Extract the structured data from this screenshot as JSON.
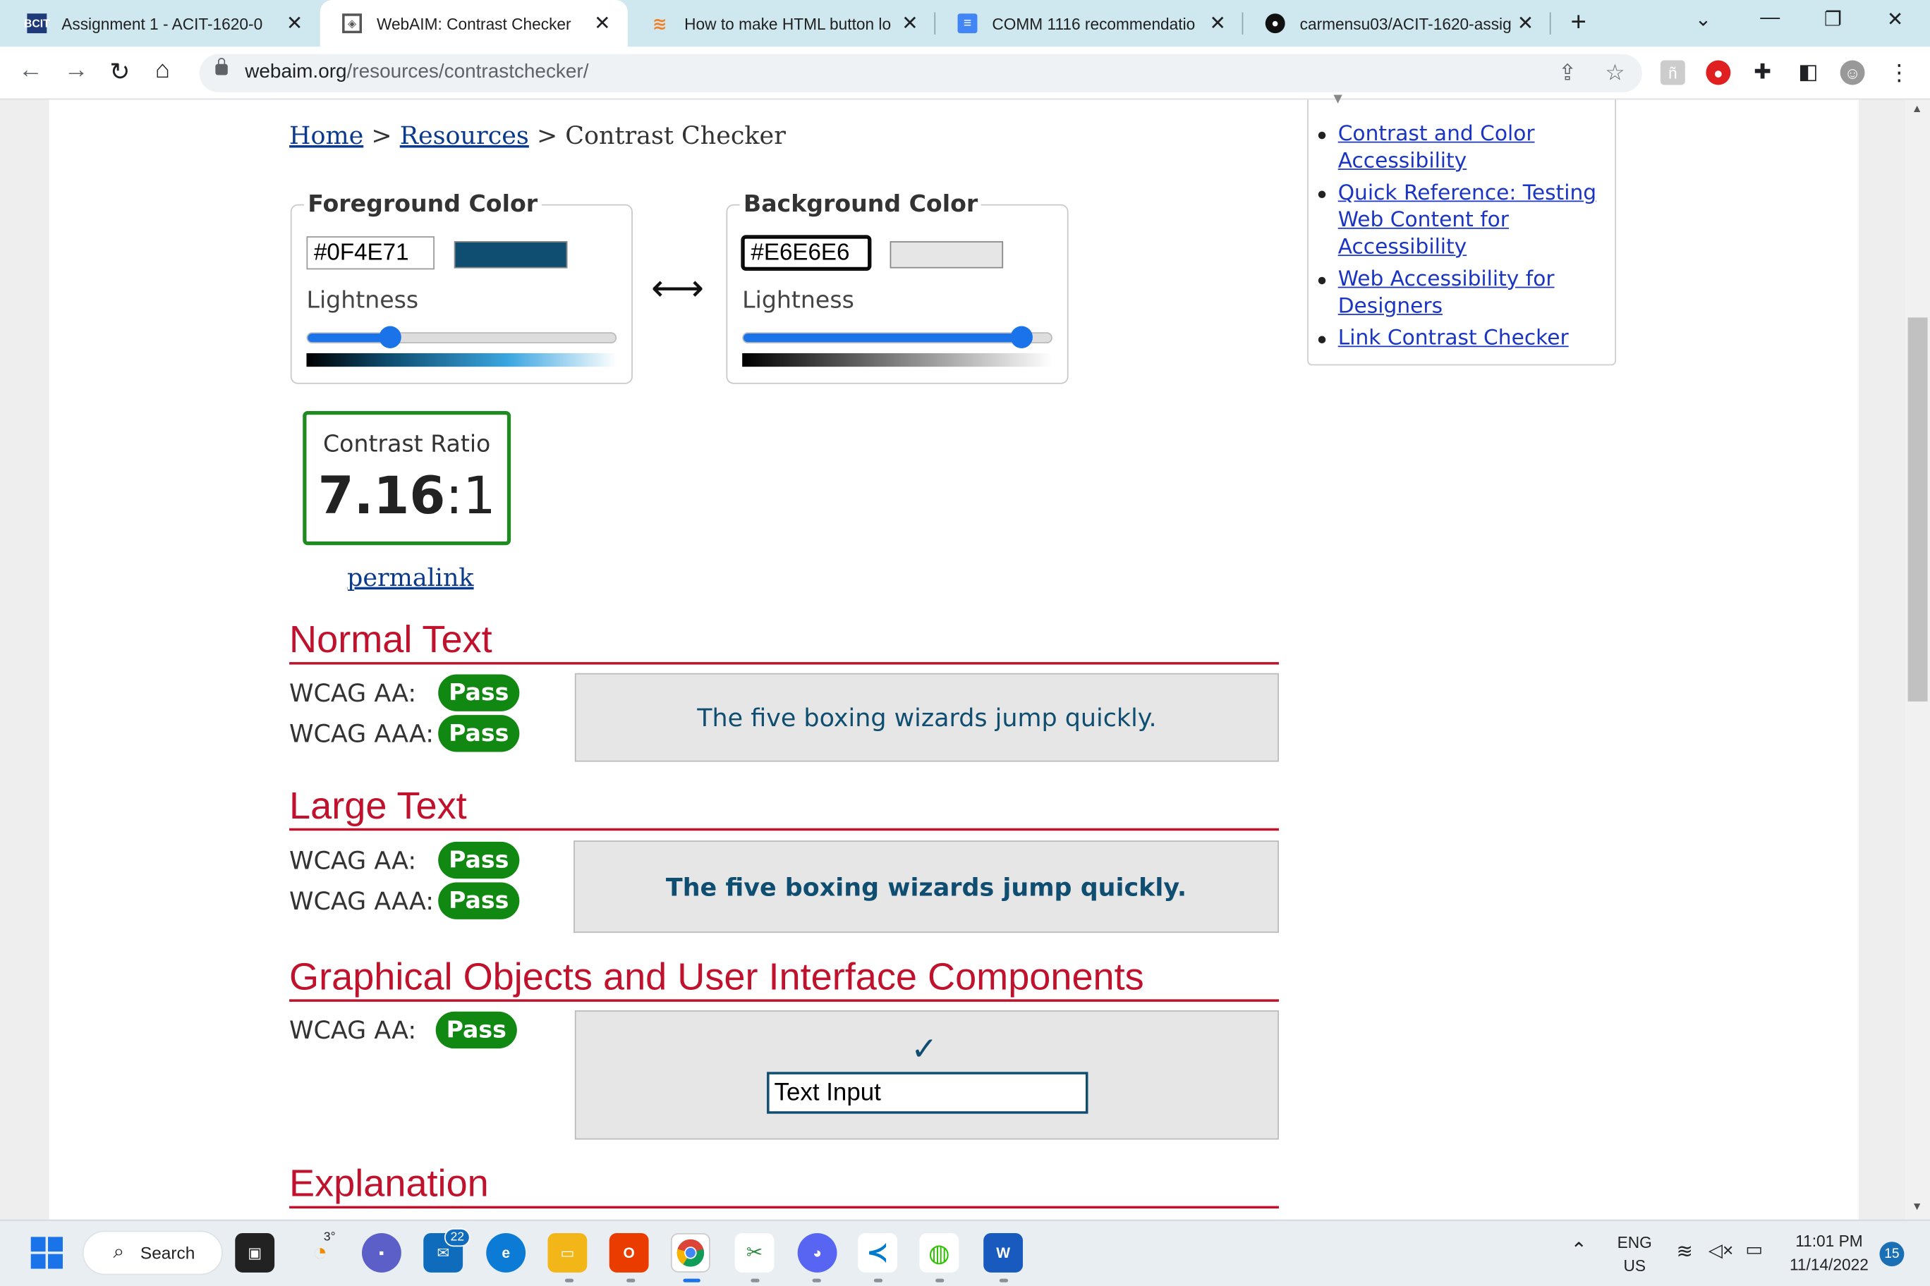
{
  "browser": {
    "tabs": [
      {
        "title": "Assignment 1 - ACIT-1620-0",
        "icon": "bcit-icon",
        "active": false
      },
      {
        "title": "WebAIM: Contrast Checker",
        "icon": "webaim-icon",
        "active": true
      },
      {
        "title": "How to make HTML button lo",
        "icon": "stackoverflow-icon",
        "active": false
      },
      {
        "title": "COMM 1116 recommendatio",
        "icon": "google-docs-icon",
        "active": false
      },
      {
        "title": "carmensu03/ACIT-1620-assig",
        "icon": "github-icon",
        "active": false
      }
    ],
    "new_tab": "+",
    "url_domain": "webaim.org",
    "url_path": "/resources/contrastchecker/"
  },
  "breadcrumb": {
    "home": "Home",
    "sep1": ">",
    "resources": "Resources",
    "sep2": ">",
    "current": "Contrast Checker"
  },
  "foreground": {
    "legend": "Foreground Color",
    "hex": "#0F4E71",
    "swatch_color": "#0F4E71",
    "lightness_label": "Lightness",
    "lightness_fraction": 0.27
  },
  "background": {
    "legend": "Background Color",
    "hex": "#E6E6E6",
    "swatch_color": "#E6E6E6",
    "lightness_label": "Lightness",
    "lightness_fraction": 0.9
  },
  "swap_glyph": "⟷",
  "contrast": {
    "label": "Contrast Ratio",
    "value_bold": "7.16",
    "value_rest": ":1",
    "permalink": "permalink"
  },
  "normal_text": {
    "heading": "Normal Text",
    "aa_label": "WCAG AA:",
    "aa_result": "Pass",
    "aaa_label": "WCAG AAA:",
    "aaa_result": "Pass",
    "sample": "The five boxing wizards jump quickly."
  },
  "large_text": {
    "heading": "Large Text",
    "aa_label": "WCAG AA:",
    "aa_result": "Pass",
    "aaa_label": "WCAG AAA:",
    "aaa_result": "Pass",
    "sample": "The five boxing wizards jump quickly."
  },
  "graphical": {
    "heading": "Graphical Objects and User Interface Components",
    "aa_label": "WCAG AA:",
    "aa_result": "Pass",
    "check_glyph": "✓",
    "input_text": "Text Input"
  },
  "explanation": {
    "heading": "Explanation"
  },
  "sidebar": {
    "links": [
      {
        "label": "Contrast and Color Accessibility"
      },
      {
        "label": "Quick Reference: Testing Web Content for Accessibility"
      },
      {
        "label": "Web Accessibility for Designers"
      },
      {
        "label": "Link Contrast Checker"
      }
    ]
  },
  "taskbar": {
    "search_label": "Search",
    "weather_temp": "3°",
    "mail_badge": "22",
    "lang_line1": "ENG",
    "lang_line2": "US",
    "time": "11:01 PM",
    "date": "11/14/2022",
    "notification_count": "15"
  },
  "colors": {
    "pass_green": "#118811",
    "heading_red": "#C0122C",
    "link_blue": "#1A35C4",
    "tab_strip": "#CFE7EE"
  }
}
